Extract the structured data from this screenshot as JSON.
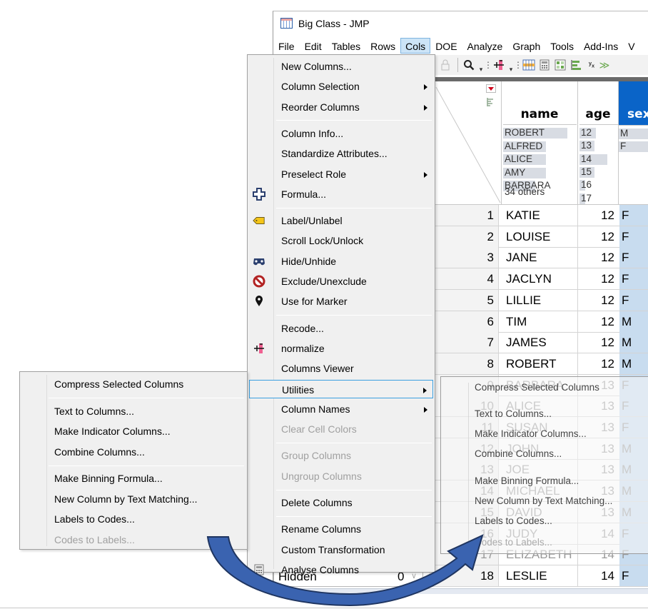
{
  "window": {
    "title": "Big Class - JMP",
    "menubar": [
      "File",
      "Edit",
      "Tables",
      "Rows",
      "Cols",
      "DOE",
      "Analyze",
      "Graph",
      "Tools",
      "Add-Ins",
      "V"
    ],
    "active_menu": "Cols",
    "toolbar_icons": [
      "lock-icon",
      "search-icon",
      "dropdown-arrow-icon",
      "normalize-icon",
      "dropdown-arrow-icon",
      "data-table-icon",
      "calculator-icon",
      "grid-icon",
      "bar-chart-icon",
      "fit-y-by-x-icon",
      "arrow-icon"
    ]
  },
  "table": {
    "columns": [
      {
        "name": "name",
        "summary": [
          "ROBERT",
          "ALFRED",
          "ALICE",
          "AMY",
          "BARBARA"
        ],
        "summary_extra": "34 others",
        "bar_fractions": [
          0.9,
          0.6,
          0.6,
          0.6,
          0.45
        ]
      },
      {
        "name": "age",
        "summary": [
          "12",
          "13",
          "14",
          "15",
          "16",
          "17"
        ],
        "bar_fractions": [
          0.45,
          0.4,
          0.75,
          0.4,
          0.15,
          0.15
        ]
      },
      {
        "name": "sex",
        "summary": [
          "M",
          "F"
        ],
        "bar_fractions": [
          1.0,
          1.0
        ],
        "selected": true
      }
    ],
    "rows": [
      {
        "n": "1",
        "name": "KATIE",
        "age": "12",
        "sex": "F"
      },
      {
        "n": "2",
        "name": "LOUISE",
        "age": "12",
        "sex": "F"
      },
      {
        "n": "3",
        "name": "JANE",
        "age": "12",
        "sex": "F"
      },
      {
        "n": "4",
        "name": "JACLYN",
        "age": "12",
        "sex": "F"
      },
      {
        "n": "5",
        "name": "LILLIE",
        "age": "12",
        "sex": "F"
      },
      {
        "n": "6",
        "name": "TIM",
        "age": "12",
        "sex": "M"
      },
      {
        "n": "7",
        "name": "JAMES",
        "age": "12",
        "sex": "M"
      },
      {
        "n": "8",
        "name": "ROBERT",
        "age": "12",
        "sex": "M"
      },
      {
        "n": "9",
        "name": "BARBARA",
        "age": "13",
        "sex": "F"
      },
      {
        "n": "10",
        "name": "ALICE",
        "age": "13",
        "sex": "F"
      },
      {
        "n": "11",
        "name": "SUSAN",
        "age": "13",
        "sex": "F"
      },
      {
        "n": "12",
        "name": "JOHN",
        "age": "13",
        "sex": "M"
      },
      {
        "n": "13",
        "name": "JOE",
        "age": "13",
        "sex": "M"
      },
      {
        "n": "14",
        "name": "MICHAEL",
        "age": "13",
        "sex": "M"
      },
      {
        "n": "15",
        "name": "DAVID",
        "age": "13",
        "sex": "M"
      },
      {
        "n": "16",
        "name": "JUDY",
        "age": "14",
        "sex": "F"
      },
      {
        "n": "17",
        "name": "ELIZABETH",
        "age": "14",
        "sex": "F"
      },
      {
        "n": "18",
        "name": "LESLIE",
        "age": "14",
        "sex": "F"
      }
    ],
    "rows_panel": {
      "label": "Hidden",
      "value": "0"
    }
  },
  "cols_menu": {
    "items": [
      {
        "label": "New Columns...",
        "submenu": false,
        "disabled": false,
        "icon": null
      },
      {
        "label": "Column Selection",
        "submenu": true,
        "disabled": false,
        "icon": null
      },
      {
        "label": "Reorder Columns",
        "submenu": true,
        "disabled": false,
        "icon": null
      },
      {
        "sep": true
      },
      {
        "label": "Column Info...",
        "submenu": false,
        "disabled": false,
        "icon": null
      },
      {
        "label": "Standardize Attributes...",
        "submenu": false,
        "disabled": false,
        "icon": null
      },
      {
        "label": "Preselect Role",
        "submenu": true,
        "disabled": false,
        "icon": null
      },
      {
        "label": "Formula...",
        "submenu": false,
        "disabled": false,
        "icon": "formula-plus-icon"
      },
      {
        "sep": true
      },
      {
        "label": "Label/Unlabel",
        "submenu": false,
        "disabled": false,
        "icon": "label-tag-icon"
      },
      {
        "label": "Scroll Lock/Unlock",
        "submenu": false,
        "disabled": false,
        "icon": null
      },
      {
        "label": "Hide/Unhide",
        "submenu": false,
        "disabled": false,
        "icon": "hide-mask-icon"
      },
      {
        "label": "Exclude/Unexclude",
        "submenu": false,
        "disabled": false,
        "icon": "exclude-icon"
      },
      {
        "label": "Use for Marker",
        "submenu": false,
        "disabled": false,
        "icon": "marker-pin-icon"
      },
      {
        "sep": true
      },
      {
        "label": "Recode...",
        "submenu": false,
        "disabled": false,
        "icon": null
      },
      {
        "label": "normalize",
        "submenu": false,
        "disabled": false,
        "icon": "normalize-icon"
      },
      {
        "label": "Columns Viewer",
        "submenu": false,
        "disabled": false,
        "icon": null
      },
      {
        "label": "Utilities",
        "submenu": true,
        "disabled": false,
        "icon": null,
        "highlighted": true
      },
      {
        "label": "Column Names",
        "submenu": true,
        "disabled": false,
        "icon": null
      },
      {
        "label": "Clear Cell Colors",
        "submenu": false,
        "disabled": true,
        "icon": null
      },
      {
        "sep": true
      },
      {
        "label": "Group Columns",
        "submenu": false,
        "disabled": true,
        "icon": null
      },
      {
        "label": "Ungroup Columns",
        "submenu": false,
        "disabled": true,
        "icon": null
      },
      {
        "sep": true
      },
      {
        "label": "Delete Columns",
        "submenu": false,
        "disabled": false,
        "icon": null
      },
      {
        "sep": true
      },
      {
        "label": "Rename Columns",
        "submenu": false,
        "disabled": false,
        "icon": null
      },
      {
        "label": "Custom Transformation",
        "submenu": false,
        "disabled": false,
        "icon": null
      },
      {
        "label": "Analyse Columns",
        "submenu": false,
        "disabled": false,
        "icon": "calculator-icon"
      }
    ]
  },
  "utilities_menu": {
    "items": [
      {
        "label": "Compress Selected Columns",
        "disabled": false
      },
      {
        "sep": true
      },
      {
        "label": "Text to Columns...",
        "disabled": false
      },
      {
        "label": "Make Indicator Columns...",
        "disabled": false
      },
      {
        "label": "Combine Columns...",
        "disabled": false
      },
      {
        "sep": true
      },
      {
        "label": "Make Binning Formula...",
        "disabled": false
      },
      {
        "label": "New Column by Text Matching...",
        "disabled": false
      },
      {
        "label": "Labels to Codes...",
        "disabled": false
      },
      {
        "label": "Codes to Labels...",
        "disabled": true
      }
    ]
  },
  "ghost_utilities_menu": {
    "items": [
      "Compress Selected Columns",
      "Text to Columns...",
      "Make Indicator Columns...",
      "Combine Columns...",
      "Make Binning Formula...",
      "New Column by Text Matching...",
      "Labels to Codes...",
      "Codes to Labels..."
    ],
    "disabled_index": 7
  },
  "annotation": {
    "arrow_color": "#3a63b0",
    "arrow_outline": "#1f3560"
  }
}
